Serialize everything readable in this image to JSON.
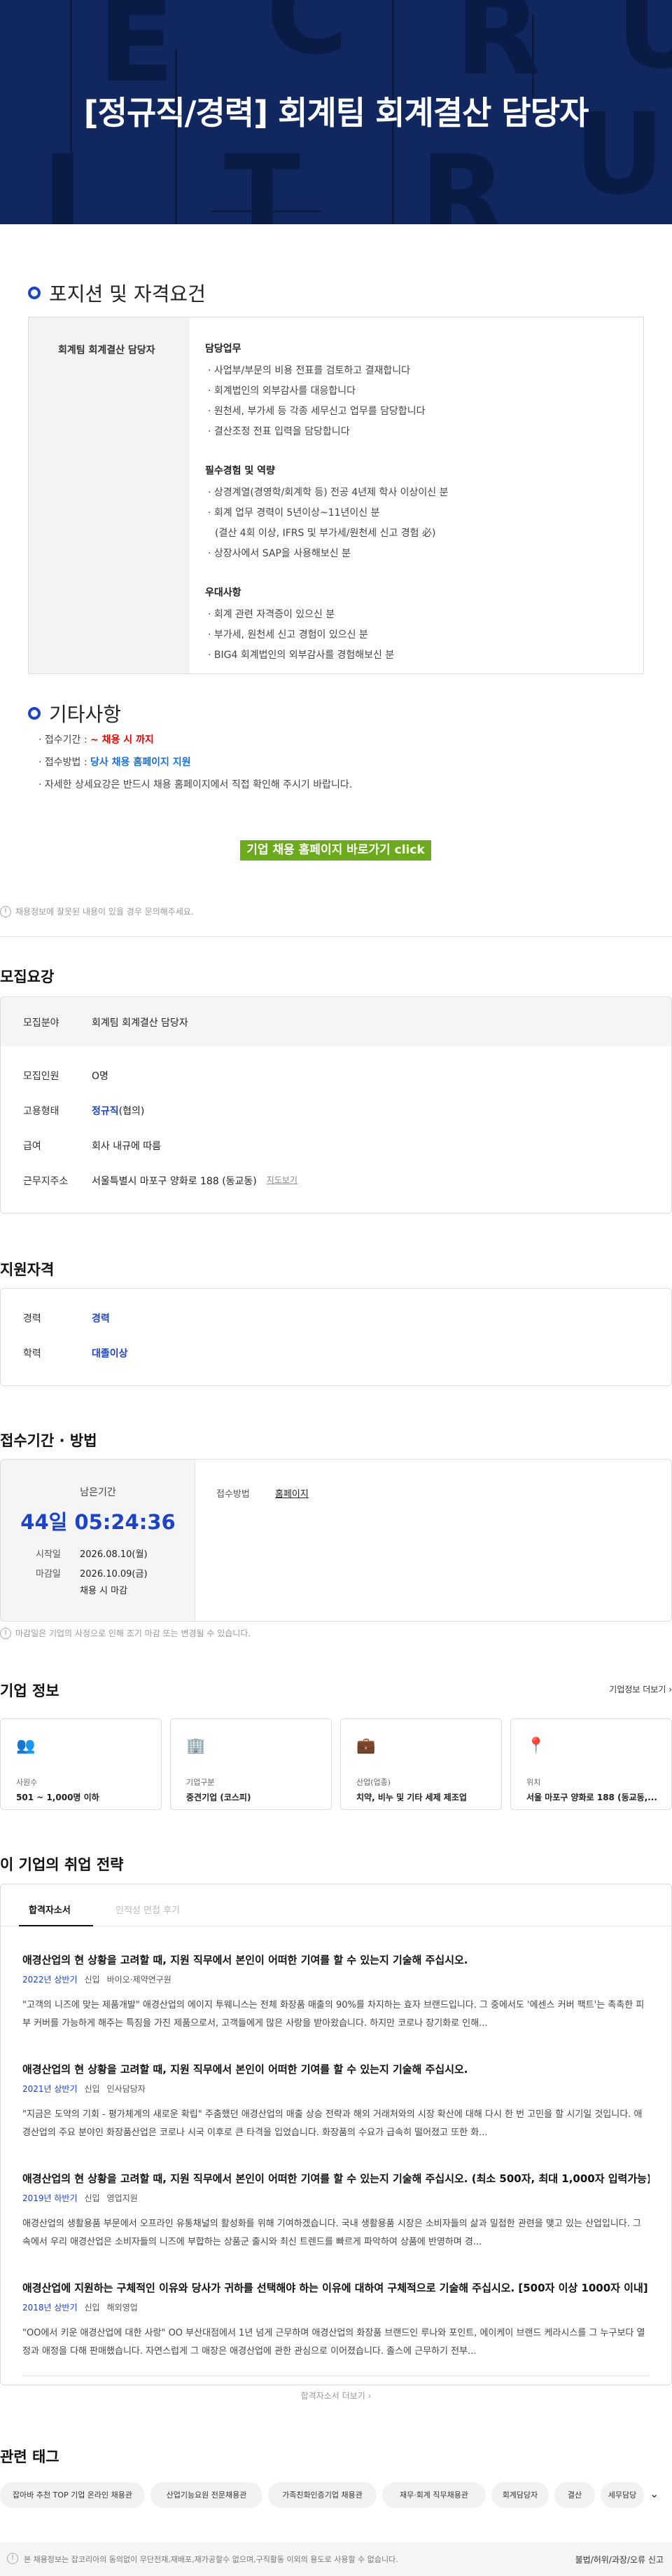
{
  "hero": {
    "title": "[정규직/경력] 회계팀 회계결산 담당자",
    "bg_letters": [
      "E",
      "C",
      "R",
      "U",
      "I",
      "T",
      "R",
      "U"
    ]
  },
  "position": {
    "section_title": "포지션 및 자격요건",
    "role": "회계팀 회계결산 담당자",
    "groups": [
      {
        "heading": "담당업무",
        "items": [
          "· 사업부/부문의 비용 전표를 검토하고 결재합니다",
          "· 회계법인의 외부감사를 대응합니다",
          "· 원천세, 부가세 등 각종 세무신고 업무를 담당합니다",
          "· 결산조정 전표 입력을 담당합니다"
        ]
      },
      {
        "heading": "필수경험 및 역량",
        "items": [
          "· 상경계열(경영학/회계학 등) 전공 4년제 학사 이상이신 분",
          "· 회계 업무 경력이 5년이상~11년이신 분",
          "  (결산 4회 이상, IFRS 및 부가세/원천세 신고 경험 必)",
          "· 상장사에서 SAP을 사용해보신 분"
        ]
      },
      {
        "heading": "우대사항",
        "items": [
          "· 회계 관련 자격증이 있으신 분",
          "· 부가세, 원천세 신고 경험이 있으신 분",
          "· BIG4 회계법인의 외부감사를 경험해보신 분"
        ]
      }
    ]
  },
  "etc": {
    "section_title": "기타사항",
    "deadline_label": "· 접수기간 : ",
    "deadline_value": "~ 채용 시 까지",
    "method_label": "· 접수방법 : ",
    "method_value": "당사 채용 홈페이지 지원",
    "detail": "· 자세한 상세요강은 반드시 채용 홈페이지에서 직접 확인해 주시기 바랍니다.",
    "button": "기업 채용 홈페이지 바로가기 click"
  },
  "notice": "채용정보에 잘못된 내용이 있을 경우 문의해주세요.",
  "summary": {
    "title": "모집요강",
    "field_label": "모집분야",
    "field_value": "회계팀 회계결산 담당자",
    "headcount_label": "모집인원",
    "headcount_value": "O명",
    "type_label": "고용형태",
    "type_value": "정규직",
    "type_suffix": "(협의)",
    "salary_label": "급여",
    "salary_value": "회사 내규에 따름",
    "location_label": "근무지주소",
    "location_value": "서울특별시 마포구 양화로 188 (동교동)",
    "map_link": "지도보기"
  },
  "qualification": {
    "title": "지원자격",
    "career_label": "경력",
    "career_value": "경력",
    "edu_label": "학력",
    "edu_value": "대졸이상"
  },
  "period": {
    "title": "접수기간 · 방법",
    "remain_label": "남은기간",
    "remain_value": "44일 05:24:36",
    "start_label": "시작일",
    "start_value": "2026.08.10(월)",
    "end_label": "마감일",
    "end_value": "2026.10.09(금)",
    "end_note": "채용 시 마감",
    "method_label": "접수방법",
    "method_value": "홈페이지",
    "note": "마감일은 기업의 사정으로 인해 조기 마감 또는 변경될 수 있습니다."
  },
  "company": {
    "title": "기업 정보",
    "more": "기업정보 더보기 ›",
    "cards": [
      {
        "icon": "people-icon",
        "glyph": "👥",
        "label": "사원수",
        "value": "501 ~ 1,000명 이하"
      },
      {
        "icon": "building-icon",
        "glyph": "🏢",
        "label": "기업구분",
        "value": "중견기업 (코스피)"
      },
      {
        "icon": "briefcase-icon",
        "glyph": "💼",
        "label": "산업(업종)",
        "value": "치약, 비누 및 기타 세제 제조업"
      },
      {
        "icon": "location-pin-icon",
        "glyph": "📍",
        "label": "위치",
        "value": "서울 마포구 양화로 188 (동교동,..."
      }
    ]
  },
  "strategy": {
    "title": "이 기업의 취업 전략",
    "tabs": [
      "합격자소서",
      "인적성 면접 후기"
    ],
    "items": [
      {
        "q": "애경산업의 현 상황을 고려할 때, 지원 직무에서 본인이 어떠한 기여를 할 수 있는지 기술해 주십시오.",
        "year": "2022년 상반기",
        "kind": "신입",
        "dept": "바이오·제약연구원",
        "a": "\"고객의 니즈에 맞는 제품개발\" 애경산업의 에이지 투웨니스는 전체 화장품 매출의 90%를 차지하는 효자 브랜드입니다. 그 중에서도 '에센스 커버 팩트'는 촉촉한 피부 커버를 가능하게 해주는 특징을 가진 제품으로서, 고객들에게 많은 사랑을 받아왔습니다. 하지만 코로나 장기화로 인해..."
      },
      {
        "q": "애경산업의 현 상황을 고려할 때, 지원 직무에서 본인이 어떠한 기여를 할 수 있는지 기술해 주십시오.",
        "year": "2021년 상반기",
        "kind": "신입",
        "dept": "인사담당자",
        "a": "\"지금은 도약의 기회 - 평가체계의 새로운 확립\" 주춤했던 애경산업의 매출 상승 전략과 해외 거래처와의 시장 확산에 대해 다시 한 번 고민을 할 시기일 것입니다. 애경산업의 주요 분야인 화장품산업은 코로나 시국 이후로 큰 타격을 입었습니다. 화장품의 수요가 급속히 떨어졌고 또한 화..."
      },
      {
        "q": "애경산업의 현 상황을 고려할 때, 지원 직무에서 본인이 어떠한 기여를 할 수 있는지 기술해 주십시오. (최소 500자, 최대 1,000자 입력가능)",
        "year": "2019년 하반기",
        "kind": "신입",
        "dept": "영업지원",
        "a": "애경산업의 생활용품 부문에서 오프라인 유통채널의 활성화를 위해 기여하겠습니다. 국내 생활용품 시장은 소비자들의 삶과 밀접한 관련을 맺고 있는 산업입니다. 그 속에서 우리 애경산업은 소비자들의 니즈에 부합하는 상품군 출시와 최신 트렌드를 빠르게 파악하여 상품에 반영하며 경..."
      },
      {
        "q": "애경산업에 지원하는 구체적인 이유와 당사가 귀하를 선택해야 하는 이유에 대하여 구체적으로 기술해 주십시오. [500자 이상 1000자 이내]",
        "year": "2018년 상반기",
        "kind": "신입",
        "dept": "해외영업",
        "a": "\"OO에서 키운 애경산업에 대한 사랑\" OO 부산대점에서 1년 넘게 근무하며 애경산업의 화장품 브랜드인 루나와 포인트, 에이케이 브랜드 케라시스를 그 누구보다 열정과 애정을 다해 판매했습니다. 자연스럽게 그 매장은 애경산업에 관한 관심으로 이어졌습니다. 졸스에 근무하기 전부..."
      }
    ],
    "more": "합격자소서 더보기 ›"
  },
  "tags": {
    "title": "관련 태그",
    "items": [
      "잡아바 추천 TOP 기업 온라인 채용관",
      "산업기능요원 전문채용관",
      "가족친화인증기업 채용관",
      "재무·회계 직무채용관",
      "회계담당자",
      "결산",
      "세무담당"
    ]
  },
  "footer": {
    "notice": "본 채용정보는 잡코리아의 동의없이 무단전재,재배포,재가공할수 없으며,구직활동 이외의 용도로 사용할 수 없습니다.",
    "report": "불법/허위/과장/오류 신고"
  }
}
